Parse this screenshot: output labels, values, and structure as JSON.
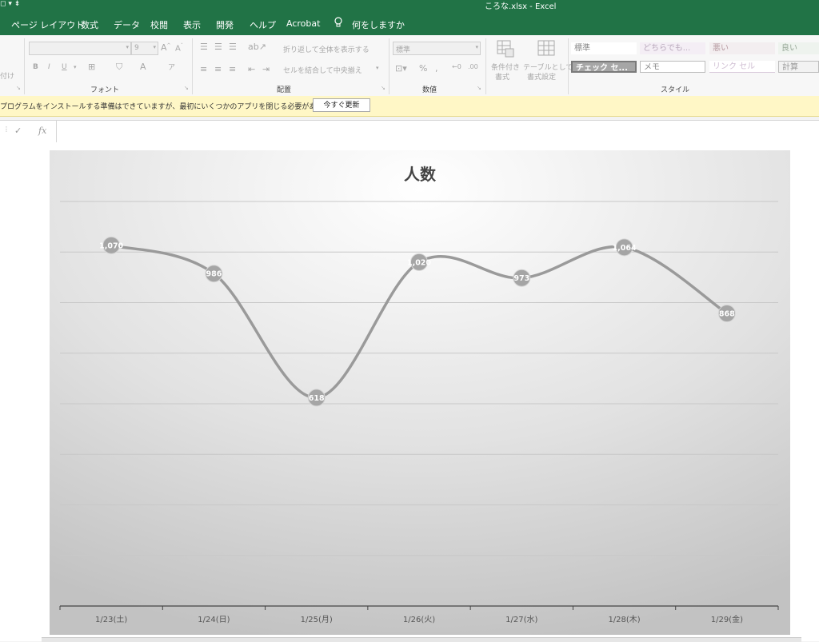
{
  "window": {
    "quick_access": "◻ ▾ ⇟",
    "title": "ころな.xlsx  -  Excel"
  },
  "menu": {
    "items": [
      "ページ レイアウト",
      "数式",
      "データ",
      "校閲",
      "表示",
      "開発",
      "ヘルプ",
      "Acrobat",
      "何をしますか"
    ],
    "tell_me_icon": "lightbulb-icon"
  },
  "ribbon": {
    "paste_partial": "付け",
    "font_size": "9",
    "font_group_label": "フォント",
    "alignment_group_label": "配置",
    "number_group_label": "数値",
    "styles_group_label": "スタイル",
    "wrap_text": "折り返して全体を表示する",
    "merge_center": "セルを結合して中央揃え",
    "number_format": "標準",
    "conditional_format": [
      "条件付き",
      "書式"
    ],
    "format_as_table": [
      "テーブルとして",
      "書式設定"
    ],
    "styles": {
      "normal": "標準",
      "neutral": "どちらでも...",
      "bad": "悪い",
      "good": "良い",
      "check_cell": "チェック セ...",
      "memo": "メモ",
      "link_cell": "リンク セル",
      "calculation": "計算"
    }
  },
  "message_bar": {
    "text": "プログラムをインストールする準備はできていますが、最初にいくつかのアプリを閉じる必要があります。",
    "button": "今すぐ更新"
  },
  "formula_bar": {
    "check_icon": "check-icon",
    "fx_label": "fx"
  },
  "colors": {
    "excel_green": "#217346",
    "line": "#9a9a9a",
    "marker": "#a5a5a5"
  },
  "chart_data": {
    "type": "line",
    "title": "人数",
    "categories": [
      "1/23(土)",
      "1/24(日)",
      "1/25(月)",
      "1/26(火)",
      "1/27(水)",
      "1/28(木)",
      "1/29(金)"
    ],
    "series": [
      {
        "values": [
          1070,
          986,
          618,
          1020,
          973,
          1064,
          868
        ],
        "labels": [
          "1,070",
          "986",
          "618",
          "1,020",
          "973",
          "1,064",
          "868"
        ]
      }
    ],
    "smooth": true,
    "ylim": [
      0,
      1200
    ],
    "gridlines": true,
    "legend": "none"
  }
}
